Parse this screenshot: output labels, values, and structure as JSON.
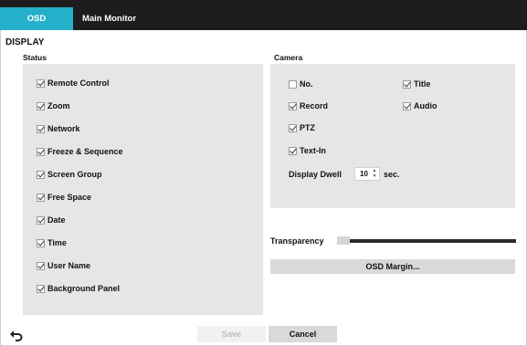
{
  "tabs": [
    {
      "label": "OSD",
      "active": true
    },
    {
      "label": "Main Monitor",
      "active": false
    }
  ],
  "section_title": "DISPLAY",
  "status": {
    "title": "Status",
    "items": [
      {
        "label": "Remote Control",
        "checked": true
      },
      {
        "label": "Zoom",
        "checked": true
      },
      {
        "label": "Network",
        "checked": true
      },
      {
        "label": "Freeze & Sequence",
        "checked": true
      },
      {
        "label": "Screen Group",
        "checked": true
      },
      {
        "label": "Free Space",
        "checked": true
      },
      {
        "label": "Date",
        "checked": true
      },
      {
        "label": "Time",
        "checked": true
      },
      {
        "label": "User Name",
        "checked": true
      },
      {
        "label": "Background Panel",
        "checked": true
      }
    ]
  },
  "camera": {
    "title": "Camera",
    "no": {
      "label": "No.",
      "checked": false
    },
    "title_opt": {
      "label": "Title",
      "checked": true
    },
    "record": {
      "label": "Record",
      "checked": true
    },
    "audio": {
      "label": "Audio",
      "checked": true
    },
    "ptz": {
      "label": "PTZ",
      "checked": true
    },
    "text_in": {
      "label": "Text-In",
      "checked": true
    },
    "display_dwell": {
      "label": "Display Dwell",
      "value": "10",
      "unit": "sec."
    }
  },
  "transparency": {
    "label": "Transparency",
    "level": 0.0
  },
  "osd_margin_label": "OSD Margin...",
  "footer": {
    "save_label": "Save",
    "cancel_label": "Cancel"
  },
  "colors": {
    "accent": "#25b0c9",
    "tabbar": "#1d1d1d",
    "panel_bg": "#e6e6e6"
  }
}
